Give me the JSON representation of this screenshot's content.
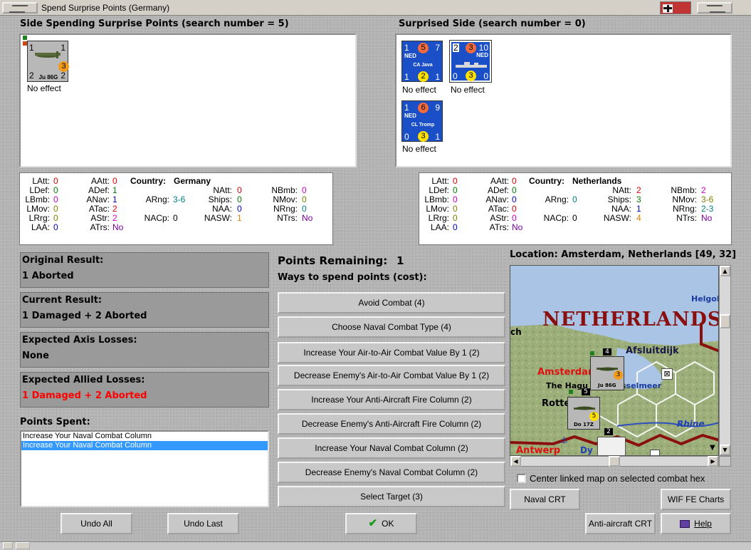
{
  "window": {
    "title": "Spend Surprise Points (Germany)"
  },
  "left_side": {
    "title": "Side Spending Surprise Points (search number = 5)",
    "units": [
      {
        "nat": "",
        "name": "Ju 86G",
        "tl": "1",
        "tr": "1",
        "bl": "2",
        "br": "2",
        "circle": "3",
        "effect": "No effect"
      }
    ]
  },
  "right_side": {
    "title": "Surprised Side (search number = 0)",
    "units": [
      {
        "nat": "NED",
        "name": "CA Java",
        "tl": "1",
        "tc": "5",
        "tr": "7",
        "bl": "1",
        "bc": "2",
        "br": "1",
        "effect": "No effect"
      },
      {
        "nat": "NED",
        "name": "",
        "tl": "2",
        "tc": "3",
        "tr": "10",
        "bl": "0",
        "bc": "3",
        "br": "0",
        "effect": "No effect"
      },
      {
        "nat": "NED",
        "name": "CL Tromp",
        "tl": "1",
        "tc": "6",
        "tr": "9",
        "bl": "0",
        "bc": "3",
        "br": "1",
        "effect": "No effect"
      }
    ]
  },
  "stats_left": {
    "country_label": "Country:",
    "country": "Germany",
    "LAtt": "0",
    "LDef": "0",
    "LBmb": "0",
    "LMov": "0",
    "LRrg": "0",
    "LAA": "0",
    "AAtt": "0",
    "ADef": "1",
    "ANav": "1",
    "ATac": "2",
    "AStr": "2",
    "ATrs": "No",
    "ARng": "3-6",
    "NACp": "0",
    "NAtt": "0",
    "Ships": "0",
    "NAA": "0",
    "NASW": "1",
    "NBmb": "0",
    "NMov": "0",
    "NRng": "0",
    "NTrs": "No"
  },
  "stats_right": {
    "country_label": "Country:",
    "country": "Netherlands",
    "LAtt": "0",
    "LDef": "0",
    "LBmb": "0",
    "LMov": "0",
    "LRrg": "0",
    "LAA": "0",
    "AAtt": "0",
    "ADef": "0",
    "ANav": "0",
    "ATac": "0",
    "AStr": "0",
    "ATrs": "No",
    "ARng": "0",
    "NACp": "0",
    "NAtt": "2",
    "Ships": "3",
    "NAA": "1",
    "NASW": "4",
    "NBmb": "2",
    "NMov": "3-6",
    "NRng": "2-3",
    "NTrs": "No"
  },
  "results": {
    "original_title": "Original Result:",
    "original_value": "1 Aborted",
    "current_title": "Current Result:",
    "current_value": "1 Damaged + 2 Aborted",
    "axis_title": "Expected Axis Losses:",
    "axis_value": "None",
    "allied_title": "Expected Allied Losses:",
    "allied_value": "1 Damaged + 2 Aborted"
  },
  "points": {
    "remaining_label": "Points Remaining:",
    "remaining_value": "1",
    "ways_label": "Ways to spend points (cost):",
    "spent_label": "Points Spent:",
    "spent": [
      "Increase Your Naval Combat Column",
      "Increase Your Naval Combat Column"
    ],
    "options": [
      "Avoid Combat (4)",
      "Choose Naval Combat Type (4)",
      "Increase Your Air-to-Air Combat Value By 1 (2)",
      "Decrease Enemy's Air-to-Air Combat Value By 1 (2)",
      "Increase Your Anti-Aircraft Fire Column (2)",
      "Decrease Enemy's Anti-Aircraft Fire Column (2)",
      "Increase Your Naval Combat Column (2)",
      "Decrease Enemy's Naval Combat Column (2)",
      "Select Target (3)"
    ]
  },
  "map": {
    "location": "Location: Amsterdam, Netherlands [49, 32]",
    "labels": {
      "country": "NETHERLANDS",
      "helgo": "Helgol",
      "afsluitdijk": "Afsluitdijk",
      "amsterdam": "Amsterdam",
      "hague": "The Hagu",
      "ijsselmeer": "sselmeer",
      "rotterdam": "Rotterd",
      "rhine": "Rhine",
      "antwerp": "Antwerp",
      "ch": "ch",
      "dy": "Dy"
    },
    "counters": {
      "ju86_name": "Ju 86G",
      "ju86_circle": "3",
      "do17_name": "Do 17Z",
      "do17_circle": "5",
      "stack_a": "4",
      "stack_b": "5",
      "stack_c": "2"
    },
    "center_checkbox_label": "Center linked map on selected combat hex"
  },
  "buttons": {
    "naval_crt": "Naval CRT",
    "wif_charts": "WIF FE Charts",
    "aa_crt": "Anti-aircraft CRT",
    "help": "Help",
    "undo_all": "Undo All",
    "undo_last": "Undo Last",
    "ok": "OK"
  },
  "colors": {
    "naval_blue": "#1a4fc8",
    "allied_loss_red": "#ff0000",
    "selection_blue": "#3399ff"
  }
}
